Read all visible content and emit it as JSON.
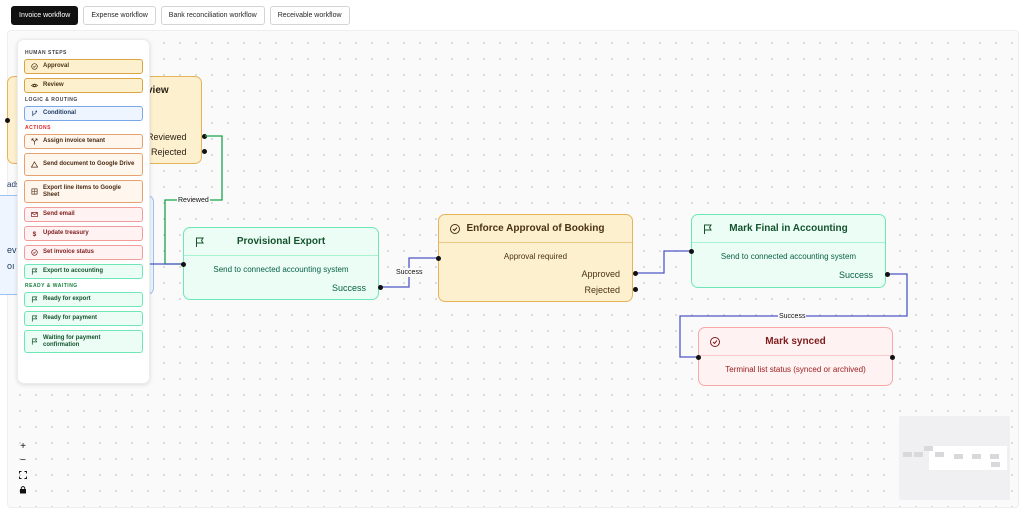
{
  "tabs": [
    {
      "label": "Invoice workflow",
      "active": true
    },
    {
      "label": "Expense workflow",
      "active": false
    },
    {
      "label": "Bank reconciliation workflow",
      "active": false
    },
    {
      "label": "Receivable workflow",
      "active": false
    }
  ],
  "palette": {
    "sections": [
      {
        "title": "HUMAN STEPS",
        "items": [
          {
            "label": "Approval",
            "icon": "check-circle-icon"
          },
          {
            "label": "Review",
            "icon": "eye-icon"
          }
        ]
      },
      {
        "title": "LOGIC & ROUTING",
        "items": [
          {
            "label": "Conditional",
            "icon": "git-branch-icon"
          }
        ]
      },
      {
        "title": "ACTIONS",
        "items": [
          {
            "label": "Assign invoice tenant",
            "icon": "split-icon"
          },
          {
            "label": "Send document to Google Drive",
            "icon": "drive-icon"
          },
          {
            "label": "Export line items to Google Sheet",
            "icon": "sheet-icon"
          },
          {
            "label": "Send email",
            "icon": "mail-icon"
          },
          {
            "label": "Update treasury",
            "icon": "dollar-icon"
          },
          {
            "label": "Set invoice status",
            "icon": "status-icon"
          },
          {
            "label": "Export to accounting",
            "icon": "flag-icon"
          }
        ]
      },
      {
        "title": "READY & WAITING",
        "items": [
          {
            "label": "Ready for export",
            "icon": "flag-icon"
          },
          {
            "label": "Ready for payment",
            "icon": "flag-icon"
          },
          {
            "label": "Waiting for payment confirmation",
            "icon": "flag-icon"
          }
        ]
      }
    ]
  },
  "nodes": {
    "review_partial": {
      "title_fragment": "view",
      "out_reviewed": "Reviewed",
      "out_rejected": "Rejected"
    },
    "side_fragments": {
      "a": "ads",
      "b": "ev",
      "c": "oı"
    },
    "provisional_export": {
      "title": "Provisional Export",
      "description": "Send to connected accounting system",
      "out_success": "Success"
    },
    "enforce_approval": {
      "title": "Enforce Approval of Booking",
      "description": "Approval required",
      "out_approved": "Approved",
      "out_rejected": "Rejected"
    },
    "mark_final": {
      "title": "Mark Final in Accounting",
      "description": "Send to connected accounting system",
      "out_success": "Success"
    },
    "mark_synced": {
      "title": "Mark synced",
      "description": "Terminal list status (synced or archived)"
    }
  },
  "edge_labels": {
    "reviewed": "Reviewed",
    "success_1": "Success",
    "success_2": "Success"
  },
  "colors": {
    "edge_green": "#16a34a",
    "edge_blue": "#4f58c8",
    "approval": "#fdf0cf",
    "export": "#ecfdf5",
    "terminal": "#fef2f2"
  },
  "controls": {
    "zoom_in": "+",
    "zoom_out": "−",
    "fit": "⛶",
    "lock": "🔒"
  }
}
